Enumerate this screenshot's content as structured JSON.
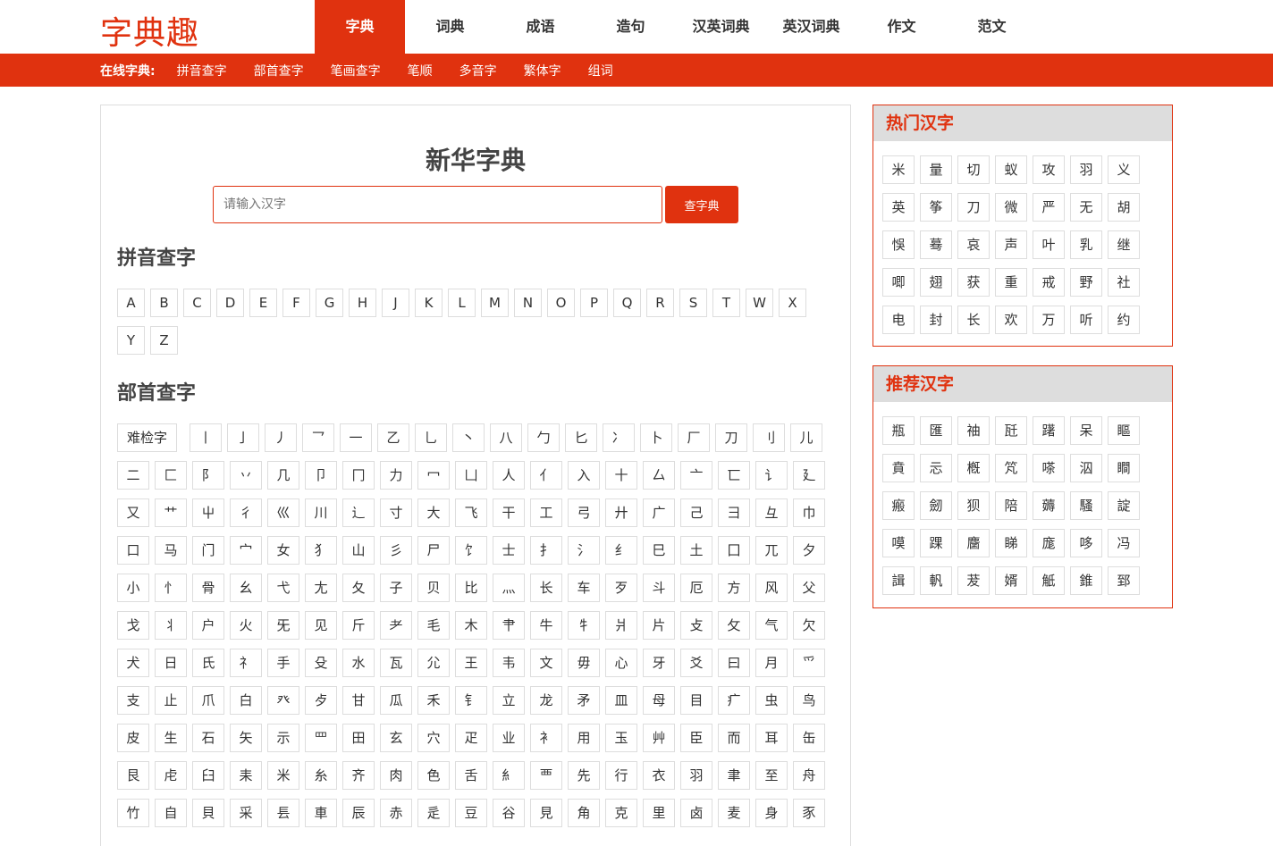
{
  "site": {
    "logo": "字典趣"
  },
  "nav": {
    "items": [
      {
        "label": "字典",
        "active": true
      },
      {
        "label": "词典",
        "active": false
      },
      {
        "label": "成语",
        "active": false
      },
      {
        "label": "造句",
        "active": false
      },
      {
        "label": "汉英词典",
        "active": false
      },
      {
        "label": "英汉词典",
        "active": false
      },
      {
        "label": "作文",
        "active": false
      },
      {
        "label": "范文",
        "active": false
      }
    ]
  },
  "subnav": {
    "label": "在线字典:",
    "links": [
      "拼音查字",
      "部首查字",
      "笔画查字",
      "笔顺",
      "多音字",
      "繁体字",
      "组词"
    ]
  },
  "main": {
    "title": "新华字典",
    "search_placeholder": "请输入汉字",
    "search_button": "查字典",
    "pinyin_title": "拼音查字",
    "pinyin_letters": [
      "A",
      "B",
      "C",
      "D",
      "E",
      "F",
      "G",
      "H",
      "J",
      "K",
      "L",
      "M",
      "N",
      "O",
      "P",
      "Q",
      "R",
      "S",
      "T",
      "W",
      "X",
      "Y",
      "Z"
    ],
    "bushou_title": "部首查字",
    "bushou_first": "难检字",
    "bushou_rows": [
      [
        "丨",
        "亅",
        "丿",
        "乛",
        "一",
        "乙",
        "乚",
        "丶",
        "八",
        "勹",
        "匕",
        "冫",
        "卜",
        "厂",
        "刀",
        "刂",
        "儿"
      ],
      [
        "二",
        "匚",
        "阝",
        "丷",
        "几",
        "卩",
        "冂",
        "力",
        "冖",
        "凵",
        "人",
        "亻",
        "入",
        "十",
        "厶",
        "亠",
        "匸",
        "讠",
        "廴"
      ],
      [
        "又",
        "艹",
        "屮",
        "彳",
        "巛",
        "川",
        "辶",
        "寸",
        "大",
        "飞",
        "干",
        "工",
        "弓",
        "廾",
        "广",
        "己",
        "彐",
        "彑",
        "巾"
      ],
      [
        "口",
        "马",
        "门",
        "宀",
        "女",
        "犭",
        "山",
        "彡",
        "尸",
        "饣",
        "士",
        "扌",
        "氵",
        "纟",
        "巳",
        "土",
        "囗",
        "兀",
        "夕"
      ],
      [
        "小",
        "忄",
        "骨",
        "幺",
        "弋",
        "尢",
        "夂",
        "子",
        "贝",
        "比",
        "灬",
        "长",
        "车",
        "歹",
        "斗",
        "厄",
        "方",
        "风",
        "父"
      ],
      [
        "戈",
        "丬",
        "户",
        "火",
        "旡",
        "见",
        "斤",
        "耂",
        "毛",
        "木",
        "肀",
        "牛",
        "牜",
        "爿",
        "片",
        "攴",
        "攵",
        "气",
        "欠"
      ],
      [
        "犬",
        "日",
        "氏",
        "礻",
        "手",
        "殳",
        "水",
        "瓦",
        "尣",
        "王",
        "韦",
        "文",
        "毋",
        "心",
        "牙",
        "爻",
        "曰",
        "月",
        "爫"
      ],
      [
        "支",
        "止",
        "爪",
        "白",
        "癶",
        "歺",
        "甘",
        "瓜",
        "禾",
        "钅",
        "立",
        "龙",
        "矛",
        "皿",
        "母",
        "目",
        "疒",
        "虫",
        "鸟"
      ],
      [
        "皮",
        "生",
        "石",
        "矢",
        "示",
        "罒",
        "田",
        "玄",
        "穴",
        "疋",
        "业",
        "衤",
        "用",
        "玉",
        "艸",
        "臣",
        "而",
        "耳",
        "缶"
      ],
      [
        "艮",
        "虍",
        "臼",
        "耒",
        "米",
        "糸",
        "齐",
        "肉",
        "色",
        "舌",
        "糹",
        "覀",
        "先",
        "行",
        "衣",
        "羽",
        "聿",
        "至",
        "舟"
      ],
      [
        "竹",
        "自",
        "貝",
        "采",
        "镸",
        "車",
        "辰",
        "赤",
        "辵",
        "豆",
        "谷",
        "見",
        "角",
        "克",
        "里",
        "卤",
        "麦",
        "身",
        "豕"
      ]
    ]
  },
  "hot": {
    "title": "热门汉字",
    "chars": [
      "米",
      "量",
      "切",
      "蚁",
      "攻",
      "羽",
      "义",
      "英",
      "筝",
      "刀",
      "微",
      "严",
      "无",
      "胡",
      "悞",
      "蓦",
      "哀",
      "声",
      "叶",
      "乳",
      "继",
      "唧",
      "翅",
      "获",
      "重",
      "戒",
      "野",
      "社",
      "电",
      "封",
      "长",
      "欢",
      "万",
      "听",
      "约"
    ]
  },
  "recommend": {
    "title": "推荐汉字",
    "chars": [
      "瓶",
      "匯",
      "䄂",
      "瓩",
      "躇",
      "呆",
      "瞘",
      "賁",
      "忈",
      "槪",
      "竼",
      "嗏",
      "泅",
      "瞷",
      "瘢",
      "劒",
      "狈",
      "陪",
      "薅",
      "騷",
      "諚",
      "嗼",
      "踝",
      "麕",
      "睇",
      "庬",
      "哆",
      "冯",
      "諿",
      "軓",
      "茇",
      "婿",
      "觗",
      "錐",
      "郅"
    ]
  },
  "colors": {
    "accent": "#e0320f",
    "border": "#dddddd",
    "side_header_bg": "#dddddd"
  }
}
